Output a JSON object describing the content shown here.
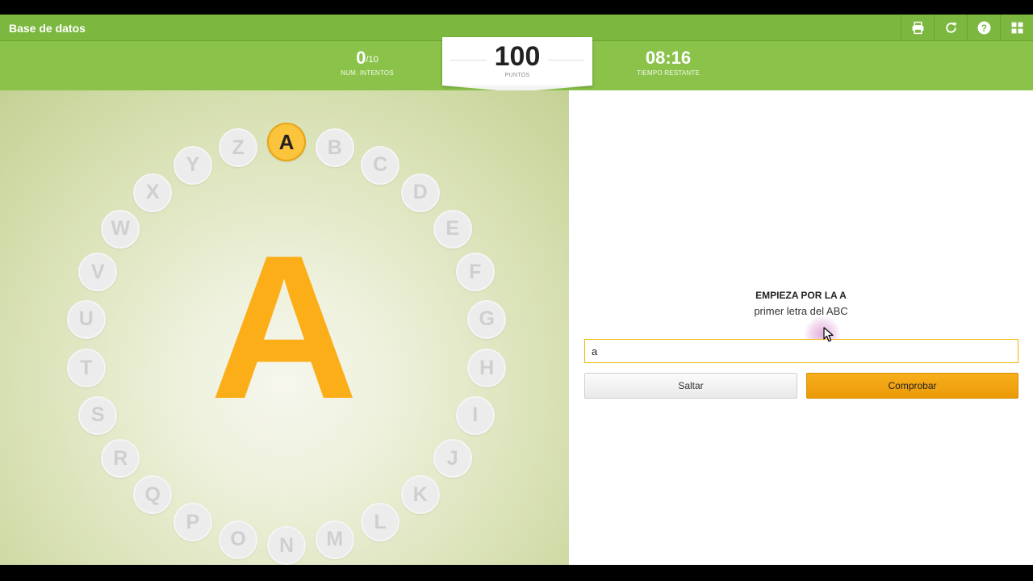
{
  "app": {
    "title": "Base de datos"
  },
  "toolbar": {
    "icons": [
      "print-icon",
      "refresh-icon",
      "help-icon",
      "grid-icon"
    ]
  },
  "stats": {
    "attempts_value": "0",
    "attempts_total": "/10",
    "attempts_label": "NUM. INTENTOS",
    "score_value": "100",
    "score_label": "PUNTOS",
    "time_value": "08:16",
    "time_label": "TIEMPO RESTANTE"
  },
  "wheel": {
    "letters": [
      "A",
      "B",
      "C",
      "D",
      "E",
      "F",
      "G",
      "H",
      "I",
      "J",
      "K",
      "L",
      "M",
      "N",
      "O",
      "P",
      "Q",
      "R",
      "S",
      "T",
      "U",
      "V",
      "W",
      "X",
      "Y",
      "Z"
    ],
    "active": "A",
    "big_letter": "A"
  },
  "question": {
    "title": "EMPIEZA POR LA A",
    "hint": "primer letra del ABC"
  },
  "answer": {
    "value": "a"
  },
  "buttons": {
    "skip": "Saltar",
    "check": "Comprobar"
  },
  "colors": {
    "topbar": "#7cb83f",
    "accent": "#fbae17",
    "active_letter": "#fcc33c"
  }
}
